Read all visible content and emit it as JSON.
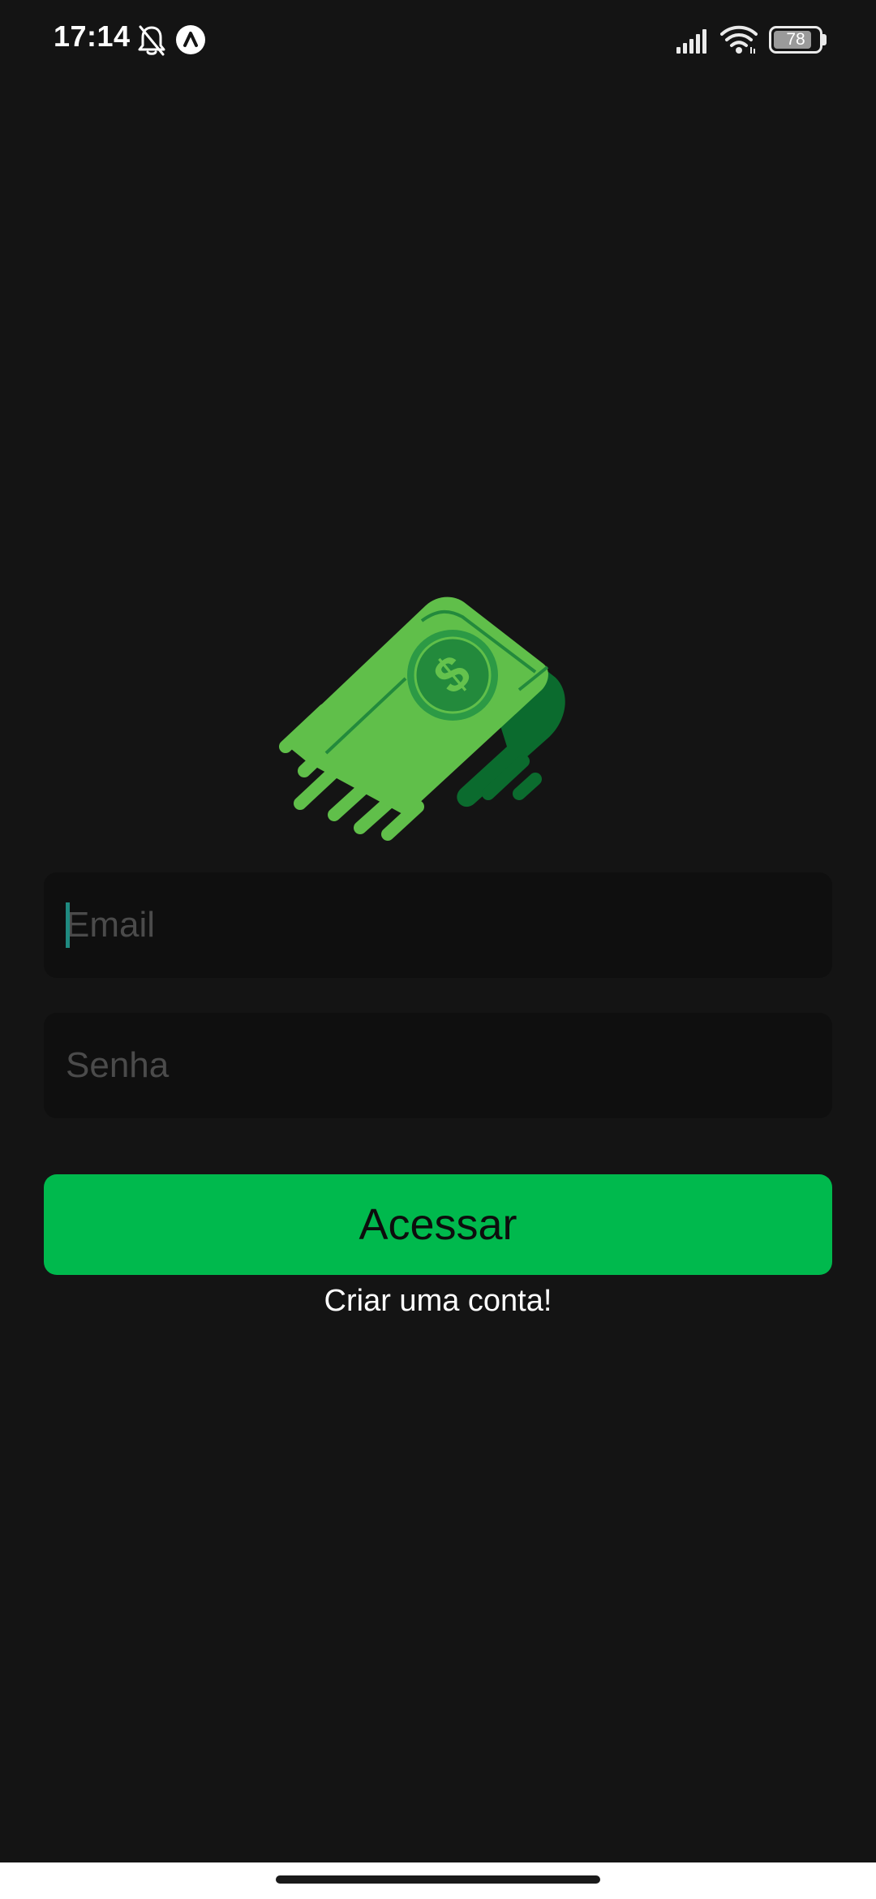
{
  "status_bar": {
    "time": "17:14",
    "battery_level": "78",
    "battery_fraction": 0.78,
    "icons": [
      "bell-off-icon",
      "app-notification-icon",
      "signal-icon",
      "wifi-icon",
      "battery-icon"
    ]
  },
  "logo": {
    "icon": "money-logo-icon",
    "colors": {
      "bill_light": "#60bf4a",
      "bill_dark": "#0b6b2e",
      "coin": "#2c9a45",
      "coin_inner": "#238a3c",
      "coin_symbol": "#64c24d",
      "coin_glyph": "$"
    }
  },
  "form": {
    "email": {
      "placeholder": "Email",
      "value": ""
    },
    "password": {
      "placeholder": "Senha",
      "value": ""
    },
    "submit_label": "Acessar",
    "create_account_label": "Criar uma conta!"
  },
  "colors": {
    "background": "#141414",
    "input_background": "#0f0f0f",
    "placeholder": "#4b4b4b",
    "accent": "#00b94d",
    "caret": "#1f8a80"
  }
}
